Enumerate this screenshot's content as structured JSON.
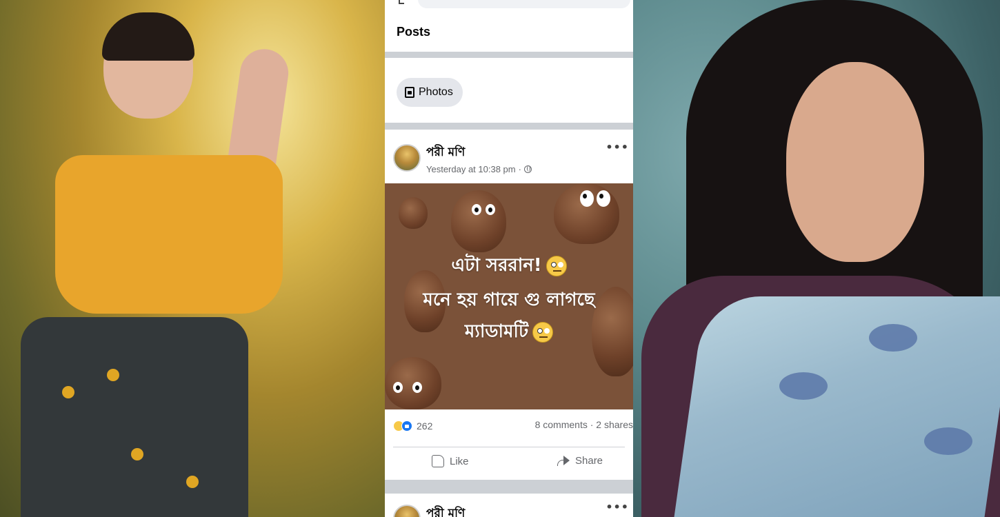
{
  "feed": {
    "section_title": "Posts",
    "photos_chip_label": "Photos"
  },
  "post": {
    "author": "পরী মণি",
    "timestamp": "Yesterday at 10:38 pm",
    "separator": "·",
    "image_text": {
      "line1": "এটা সররান!",
      "line2": "মনে হয় গায়ে গু লাগছে",
      "line3": "ম্যাডামটি"
    },
    "reactions_count": "262",
    "comments": "8 comments",
    "shares": "2 shares",
    "like_label": "Like",
    "share_label": "Share"
  },
  "next_post": {
    "author": "পরী মণি"
  },
  "colors": {
    "post_image_bg": "#7b5239",
    "accent_blue": "#1877f2",
    "chip_bg": "#e4e6eb"
  },
  "icons": {
    "photos": "photos-icon",
    "globe": "globe-icon",
    "more": "more-icon",
    "like": "thumb-icon",
    "share": "share-icon"
  }
}
